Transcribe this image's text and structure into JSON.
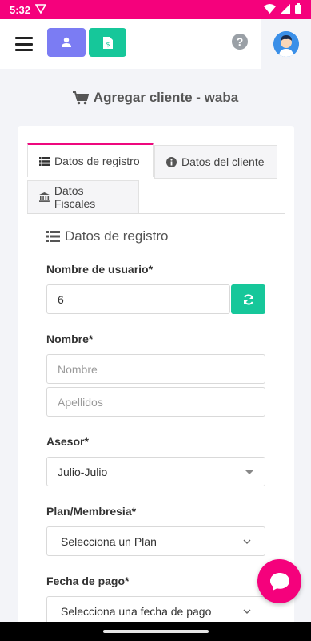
{
  "status_bar": {
    "time": "5:32"
  },
  "header": {},
  "page": {
    "title": "Agregar cliente - waba"
  },
  "tabs": [
    {
      "label": "Datos de registro"
    },
    {
      "label": "Datos del cliente"
    },
    {
      "label": "Datos Fiscales"
    }
  ],
  "section": {
    "title": "Datos de registro"
  },
  "form": {
    "username": {
      "label": "Nombre de usuario*",
      "value": "6"
    },
    "name": {
      "label": "Nombre*",
      "first_placeholder": "Nombre",
      "last_placeholder": "Apellidos"
    },
    "advisor": {
      "label": "Asesor*",
      "value": "Julio-Julio"
    },
    "plan": {
      "label": "Plan/Membresia*",
      "value": "Selecciona un Plan"
    },
    "payment_date": {
      "label": "Fecha de pago*",
      "value": "Selecciona una fecha de pago"
    }
  },
  "colors": {
    "brand_pink": "#f5017c",
    "green": "#16c79a",
    "purple": "#7b7cf3"
  }
}
